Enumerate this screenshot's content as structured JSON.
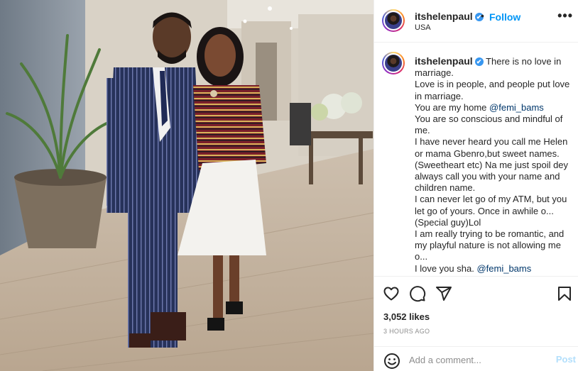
{
  "post": {
    "username": "itshelenpaul",
    "location": "USA",
    "follow_label": "Follow",
    "dot": "•",
    "more_glyph": "•••",
    "verified_glyph": "✔",
    "caption_lines": [
      "There is no love in marriage.",
      "Love is in people, and people put love in marriage.",
      "You are my home ",
      "You are so conscious and mindful of me.",
      "I have never heard you call me Helen or mama Gbenro,but sweet names. (Sweetheart etc) Na me just spoil dey always call you with your name and children name.",
      "I can never let go of my ATM, but you let go of yours. Once in awhile o...(Special guy)Lol",
      "I am really trying to be romantic, and my playful nature is not allowing me o...",
      "I love you sha. "
    ],
    "mention": "@femi_bams",
    "likes": "3,052 likes",
    "time_ago": "3 HOURS AGO",
    "comment_placeholder": "Add a comment...",
    "post_label": "Post"
  },
  "icons": {
    "like": "heart-icon",
    "comment": "comment-icon",
    "share": "send-icon",
    "save": "bookmark-icon",
    "emoji": "emoji-icon"
  },
  "colors": {
    "accent": "#0095f6",
    "verified": "#3897f0",
    "mention": "#00376b",
    "muted": "#8e8e8e",
    "post_disabled": "#b2dffc"
  }
}
